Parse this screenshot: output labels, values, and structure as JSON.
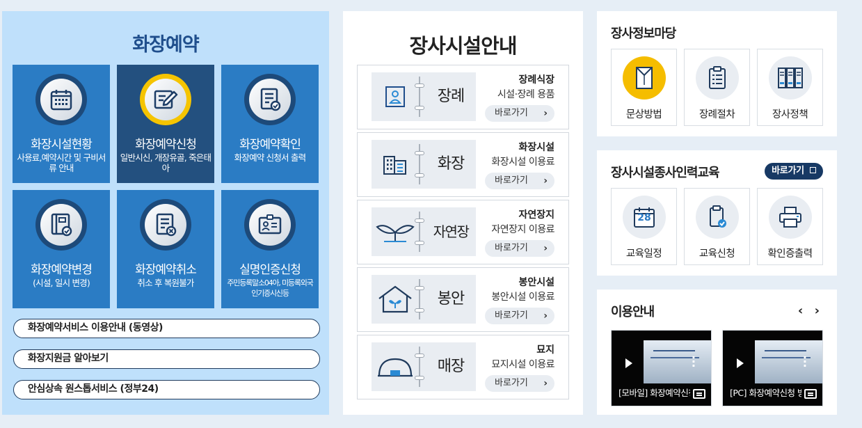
{
  "cremation": {
    "title": "화장예약",
    "tiles": [
      {
        "title": "화장시설현황",
        "desc": "사용료,예약시간 및 구비서류 안내"
      },
      {
        "title": "화장예약신청",
        "desc": "일반시신, 개장유골, 죽은태아"
      },
      {
        "title": "화장예약확인",
        "desc": "화장예약 신청서 출력"
      },
      {
        "title": "화장예약변경",
        "desc": "(시설, 일시 변경)"
      },
      {
        "title": "화장예약취소",
        "desc": "취소 후 복원불가"
      },
      {
        "title": "실명인증신청",
        "desc": "주민등록말소04아, 미등록외국인기증시신등"
      }
    ],
    "links": [
      "화장예약서비스 이용안내 (동영상)",
      "화장지원금 알아보기",
      "안심상속 원스톱서비스 (정부24)"
    ]
  },
  "facilities": {
    "title": "장사시설안내",
    "items": [
      {
        "name": "장례",
        "info_title": "장례식장",
        "info_sub": "시설·장례 용품",
        "go": "바로가기"
      },
      {
        "name": "화장",
        "info_title": "화장시설",
        "info_sub": "화장시설 이용료",
        "go": "바로가기"
      },
      {
        "name": "자연장",
        "info_title": "자연장지",
        "info_sub": "자연장지 이용료",
        "go": "바로가기"
      },
      {
        "name": "봉안",
        "info_title": "봉안시설",
        "info_sub": "봉안시설 이용료",
        "go": "바로가기"
      },
      {
        "name": "매장",
        "info_title": "묘지",
        "info_sub": "묘지시설 이용료",
        "go": "바로가기"
      }
    ]
  },
  "funeral_info": {
    "title": "장사정보마당",
    "cards": [
      "문상방법",
      "장례절차",
      "장사정책"
    ]
  },
  "education": {
    "title": "장사시설종사인력교육",
    "badge": "바로가기",
    "calendar_day": "28",
    "cards": [
      "교육일정",
      "교육신청",
      "확인증출력"
    ]
  },
  "guide": {
    "title": "이용안내",
    "arrows": "‹ ›",
    "videos": [
      "[모바일] 화장예약신청 방법",
      "[PC] 화장예약신청 방법"
    ]
  },
  "colors": {
    "left_bg": "#bfe0fb",
    "tile_blue": "#2b7cc4",
    "tile_selected": "#23507f",
    "highlight": "#f5c400",
    "badge": "#173964"
  }
}
